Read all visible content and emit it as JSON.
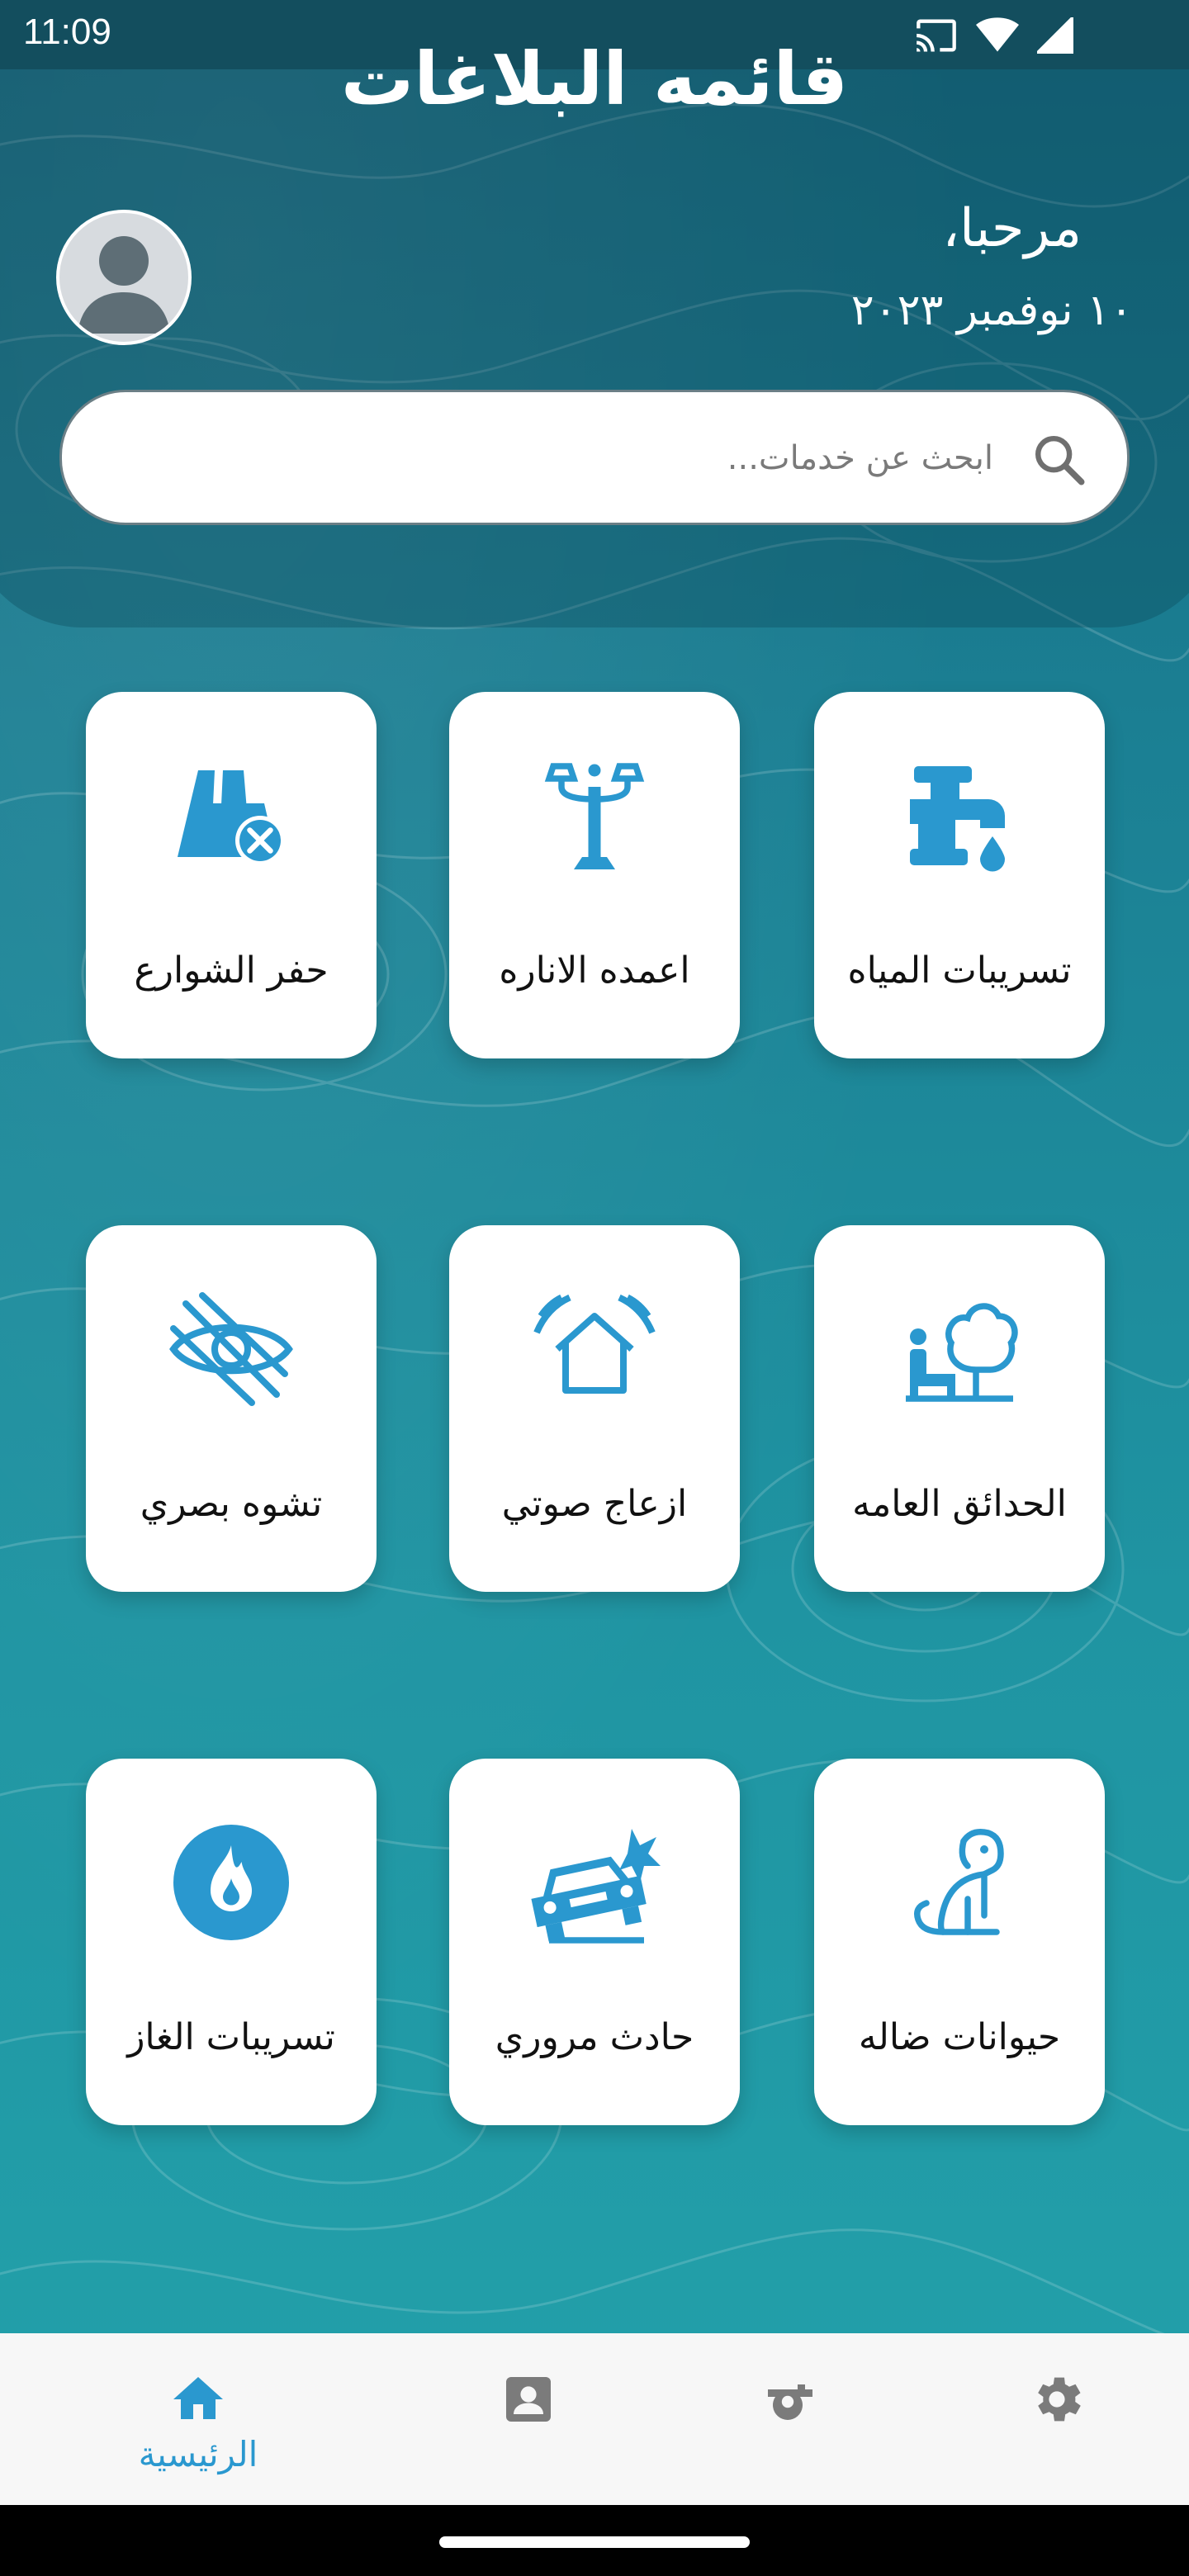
{
  "status_bar": {
    "time": "11:09",
    "icons": [
      "cast-icon",
      "wifi-icon",
      "signal-icon"
    ]
  },
  "header": {
    "title": "قائمه البلاغات",
    "greeting": "مرحبا،",
    "date": "١٠ نوفمبر ٢٠٢٣"
  },
  "search": {
    "placeholder": "ابحث عن خدمات..."
  },
  "services": [
    {
      "label": "تسريبات المياه",
      "icon": "water-leak-icon"
    },
    {
      "label": "اعمده الاناره",
      "icon": "street-light-icon"
    },
    {
      "label": "حفر الشوارع",
      "icon": "road-hole-icon"
    },
    {
      "label": "الحدائق العامه",
      "icon": "park-icon"
    },
    {
      "label": "ازعاج صوتي",
      "icon": "noise-icon"
    },
    {
      "label": "تشوه بصري",
      "icon": "visual-distortion-icon"
    },
    {
      "label": "حيوانات ضاله",
      "icon": "stray-animal-icon"
    },
    {
      "label": "حادث مروري",
      "icon": "car-accident-icon"
    },
    {
      "label": "تسريبات الغاز",
      "icon": "gas-leak-icon"
    }
  ],
  "bottom_nav": {
    "active_label": "الرئيسية",
    "items": [
      "home-icon",
      "contact-icon",
      "whistle-icon",
      "settings-icon"
    ]
  },
  "colors": {
    "accent": "#2a98cf",
    "teal_dark": "#17687e",
    "teal_light": "#23a2ab",
    "nav_icon_gray": "#7b7b7b"
  }
}
